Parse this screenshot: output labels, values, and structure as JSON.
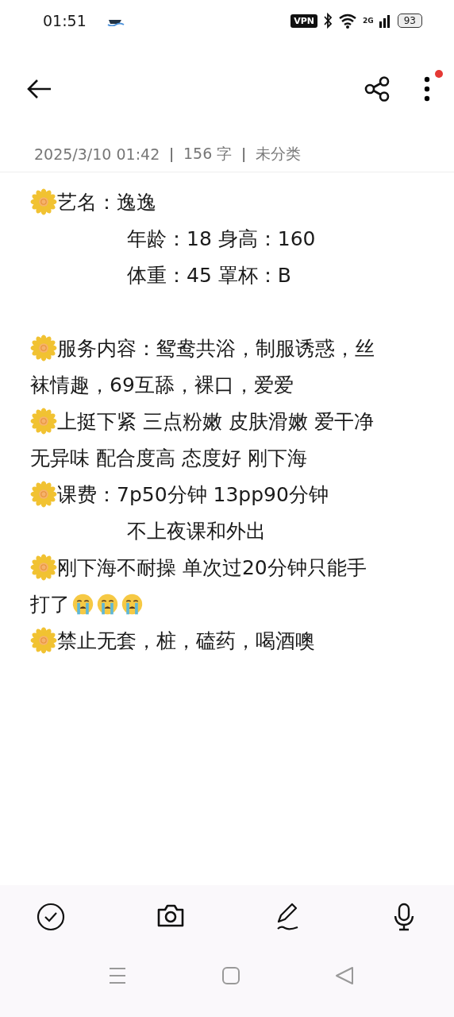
{
  "status_bar": {
    "time": "01:51",
    "vpn": "VPN",
    "network": "2G",
    "battery": "93"
  },
  "note_meta": [
    {
      "kind": "text",
      "text": "2025/3/10 01:42"
    },
    {
      "kind": "separator",
      "text": "|"
    },
    {
      "kind": "text",
      "text": "156 字"
    },
    {
      "kind": "separator",
      "text": "|"
    },
    {
      "kind": "text",
      "text": "未分类"
    }
  ],
  "note_lines": [
    {
      "kind": "bullet",
      "parts": [
        {
          "kind": "text",
          "text": "艺名：逸逸"
        }
      ]
    },
    {
      "kind": "indent",
      "parts": [
        {
          "kind": "text",
          "text": "年龄：18 身高：160"
        }
      ]
    },
    {
      "kind": "indent",
      "parts": [
        {
          "kind": "text",
          "text": "体重：45 罩杯：B"
        }
      ]
    },
    {
      "kind": "blank"
    },
    {
      "kind": "bullet",
      "parts": [
        {
          "kind": "text",
          "text": "服务内容：鸳鸯共浴，制服诱惑，丝"
        }
      ]
    },
    {
      "kind": "plain",
      "parts": [
        {
          "kind": "text",
          "text": "袜情趣，69互舔，裸口，爱爱"
        }
      ]
    },
    {
      "kind": "bullet",
      "parts": [
        {
          "kind": "text",
          "text": "上挺下紧 三点粉嫩 皮肤滑嫩 爱干净"
        }
      ]
    },
    {
      "kind": "plain",
      "parts": [
        {
          "kind": "text",
          "text": "无异味 配合度高 态度好 刚下海"
        }
      ]
    },
    {
      "kind": "bullet",
      "parts": [
        {
          "kind": "text",
          "text": "课费：7p50分钟  13pp90分钟"
        }
      ]
    },
    {
      "kind": "indent",
      "parts": [
        {
          "kind": "text",
          "text": "不上夜课和外出"
        }
      ]
    },
    {
      "kind": "bullet",
      "parts": [
        {
          "kind": "text",
          "text": "刚下海不耐操 单次过20分钟只能手"
        }
      ]
    },
    {
      "kind": "plain",
      "parts": [
        {
          "kind": "text",
          "text": "打了"
        },
        {
          "kind": "crying-emoji"
        },
        {
          "kind": "crying-emoji"
        },
        {
          "kind": "crying-emoji"
        }
      ]
    },
    {
      "kind": "bullet",
      "parts": [
        {
          "kind": "text",
          "text": "禁止无套，桩，磕药，喝酒噢"
        }
      ]
    }
  ]
}
